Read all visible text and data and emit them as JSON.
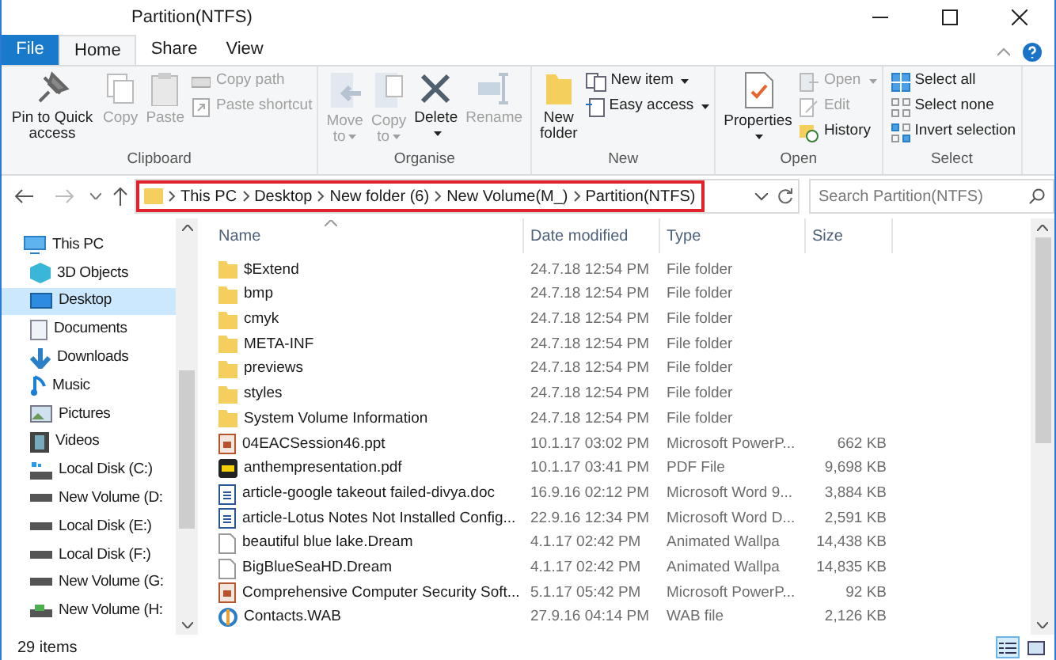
{
  "window": {
    "title": "Partition(NTFS)"
  },
  "tabs": [
    {
      "label": "File",
      "kind": "file",
      "selected": false
    },
    {
      "label": "Home",
      "kind": "tab",
      "selected": true
    },
    {
      "label": "Share",
      "kind": "tab",
      "selected": false
    },
    {
      "label": "View",
      "kind": "tab",
      "selected": false
    }
  ],
  "ribbon": [
    {
      "label": "Clipboard",
      "large": [
        {
          "label": "Pin to Quick access",
          "disabled": false
        },
        {
          "label": "Copy",
          "disabled": true
        },
        {
          "label": "Paste",
          "disabled": true
        }
      ],
      "small": [
        {
          "label": "Copy path",
          "disabled": true
        },
        {
          "label": "Paste shortcut",
          "disabled": true
        }
      ]
    },
    {
      "label": "Organise",
      "large": [
        {
          "label": "Move to",
          "disabled": true,
          "dropdown": true
        },
        {
          "label": "Copy to",
          "disabled": true,
          "dropdown": true
        },
        {
          "label": "Delete",
          "disabled": false,
          "dropdown": true
        },
        {
          "label": "Rename",
          "disabled": true,
          "dropdown": false
        }
      ]
    },
    {
      "label": "New",
      "large": [
        {
          "label": "New folder",
          "disabled": false
        }
      ],
      "small": [
        {
          "label": "New item",
          "disabled": false,
          "dropdown": true
        },
        {
          "label": "Easy access",
          "disabled": false,
          "dropdown": true
        }
      ]
    },
    {
      "label": "Open",
      "large": [
        {
          "label": "Properties",
          "disabled": false,
          "dropdown": true
        }
      ],
      "small": [
        {
          "label": "Open",
          "disabled": true,
          "dropdown": true
        },
        {
          "label": "Edit",
          "disabled": true,
          "dropdown": false
        },
        {
          "label": "History",
          "disabled": false,
          "dropdown": false
        }
      ]
    },
    {
      "label": "Select",
      "small": [
        {
          "label": "Select all",
          "disabled": false
        },
        {
          "label": "Select none",
          "disabled": false
        },
        {
          "label": "Invert selection",
          "disabled": false
        }
      ]
    }
  ],
  "breadcrumb": [
    "This PC",
    "Desktop",
    "New folder (6)",
    "New Volume(M_)",
    "Partition(NTFS)"
  ],
  "search": {
    "placeholder": "Search Partition(NTFS)"
  },
  "sidebar": {
    "items": [
      {
        "label": "This PC",
        "selected": false,
        "children": [
          {
            "label": "3D Objects",
            "selected": false
          },
          {
            "label": "Desktop",
            "selected": true
          },
          {
            "label": "Documents",
            "selected": false
          },
          {
            "label": "Downloads",
            "selected": false
          },
          {
            "label": "Music",
            "selected": false
          },
          {
            "label": "Pictures",
            "selected": false
          },
          {
            "label": "Videos",
            "selected": false
          },
          {
            "label": "Local Disk (C:)",
            "selected": false
          },
          {
            "label": "New Volume (D:",
            "selected": false
          },
          {
            "label": "Local Disk (E:)",
            "selected": false
          },
          {
            "label": "Local Disk (F:)",
            "selected": false
          },
          {
            "label": "New Volume (G:",
            "selected": false
          },
          {
            "label": "New Volume (H:",
            "selected": false
          }
        ]
      }
    ]
  },
  "table": {
    "columns": [
      "Name",
      "Date modified",
      "Type",
      "Size"
    ],
    "rows": [
      {
        "kind": "folder",
        "name": "$Extend",
        "date": "24.7.18 12:54 PM",
        "type": "File folder"
      },
      {
        "kind": "folder",
        "name": "bmp",
        "date": "24.7.18 12:54 PM",
        "type": "File folder"
      },
      {
        "kind": "folder",
        "name": "cmyk",
        "date": "24.7.18 12:54 PM",
        "type": "File folder"
      },
      {
        "kind": "folder",
        "name": "META-INF",
        "date": "24.7.18 12:54 PM",
        "type": "File folder"
      },
      {
        "kind": "folder",
        "name": "previews",
        "date": "24.7.18 12:54 PM",
        "type": "File folder"
      },
      {
        "kind": "folder",
        "name": "styles",
        "date": "24.7.18 12:54 PM",
        "type": "File folder"
      },
      {
        "kind": "folder",
        "name": "System Volume Information",
        "date": "24.7.18 12:54 PM",
        "type": "File folder"
      },
      {
        "kind": "ppt",
        "name": "04EACSession46.ppt",
        "date": "10.1.17 03:02 PM",
        "type": "Microsoft PowerP...",
        "size": "662 KB"
      },
      {
        "kind": "pdf",
        "name": "anthempresentation.pdf",
        "date": "10.1.17 03:41 PM",
        "type": "PDF File",
        "size": "9,698 KB"
      },
      {
        "kind": "doc",
        "name": "article-google takeout failed-divya.doc",
        "date": "16.9.16 02:12 PM",
        "type": "Microsoft Word 9...",
        "size": "3,884 KB"
      },
      {
        "kind": "doc",
        "name": "article-Lotus Notes Not Installed  Config...",
        "date": "22.9.16 12:34 PM",
        "type": "Microsoft Word D...",
        "size": "2,591 KB"
      },
      {
        "kind": "file",
        "name": "beautiful blue lake.Dream",
        "date": "4.1.17 02:42 PM",
        "type": "Animated Wallpa",
        "size": "14,438 KB"
      },
      {
        "kind": "file",
        "name": "BigBlueSeaHD.Dream",
        "date": "4.1.17 02:42 PM",
        "type": "Animated Wallpa",
        "size": "14,835 KB"
      },
      {
        "kind": "ppt",
        "name": "Comprehensive Computer Security Soft...",
        "date": "5.1.17 05:42 PM",
        "type": "Microsoft PowerP...",
        "size": "92 KB"
      },
      {
        "kind": "wab",
        "name": "Contacts.WAB",
        "date": "27.9.16 04:14 PM",
        "type": "WAB file",
        "size": "2,126 KB"
      }
    ]
  },
  "status_bar": {
    "text": "29 items"
  }
}
